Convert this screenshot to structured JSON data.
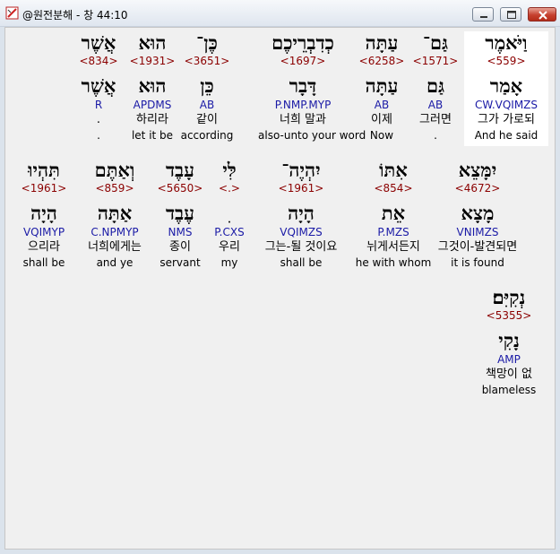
{
  "window": {
    "title": "@원전분해 - 창 44:10"
  },
  "words": [
    {
      "heb": "וַיֹּאמֶר",
      "num": "<559>",
      "lemma": "אָמַר",
      "morph": "CW.VQIMZS",
      "kor": "그가 가로되",
      "eng": "And he said",
      "selected": true
    },
    {
      "heb": "גַּם־",
      "num": "<1571>",
      "lemma": "גַּם",
      "morph": "AB",
      "kor": "그러면",
      "eng": "."
    },
    {
      "heb": "עַתָּה",
      "num": "<6258>",
      "lemma": "עַתָּה",
      "morph": "AB",
      "kor": "이제",
      "eng": "Now"
    },
    {
      "heb": "כְדִבְרֵיכֶם",
      "num": "<1697>",
      "lemma": "דָּבָר",
      "morph": "P.NMP.MYP",
      "kor": "너희 말과",
      "eng": "also-unto your word"
    },
    {
      "heb": "כֶּן־",
      "num": "<3651>",
      "lemma": "כֵּן",
      "morph": "AB",
      "kor": "같이",
      "eng": "according"
    },
    {
      "heb": "הוּא",
      "num": "<1931>",
      "lemma": "הוּא",
      "morph": "APDMS",
      "kor": "하리라",
      "eng": "let it be"
    },
    {
      "heb": "אֲשֶׁר",
      "num": "<834>",
      "lemma": "אֲשֶׁר",
      "morph": "R",
      "kor": ".",
      "eng": "."
    },
    {
      "heb": "יִמָּצֵא",
      "num": "<4672>",
      "lemma": "מָצָא",
      "morph": "VNIMZS",
      "kor": "그것이-발견되면",
      "eng": "it is found"
    },
    {
      "heb": "אִתּוֹ",
      "num": "<854>",
      "lemma": "אֵת",
      "morph": "P.MZS",
      "kor": "뉘게서든지",
      "eng": "he with whom"
    },
    {
      "heb": "יִהְיֶה־",
      "num": "<1961>",
      "lemma": "הָיָה",
      "morph": "VQIMZS",
      "kor": "그는-될 것이요",
      "eng": "shall be"
    },
    {
      "heb": "לִּי",
      "num": "<.>",
      "lemma": "ִ",
      "morph": "P.CXS",
      "kor": "우리",
      "eng": "my"
    },
    {
      "heb": "עָבֶד",
      "num": "<5650>",
      "lemma": "עֶבֶד",
      "morph": "NMS",
      "kor": "종이",
      "eng": "servant"
    },
    {
      "heb": "וְאַתֶּם",
      "num": "<859>",
      "lemma": "אַתָּה",
      "morph": "C.NPMYP",
      "kor": "너희에게는",
      "eng": "and ye"
    },
    {
      "heb": "תִּהְיוּ",
      "num": "<1961>",
      "lemma": "הָיָה",
      "morph": "VQIMYP",
      "kor": "으리라",
      "eng": "shall be"
    },
    {
      "heb": "נְקִיִּם׃",
      "num": "<5355>",
      "lemma": "נָקִי",
      "morph": "AMP",
      "kor": "책망이 없",
      "eng": "blameless"
    }
  ]
}
